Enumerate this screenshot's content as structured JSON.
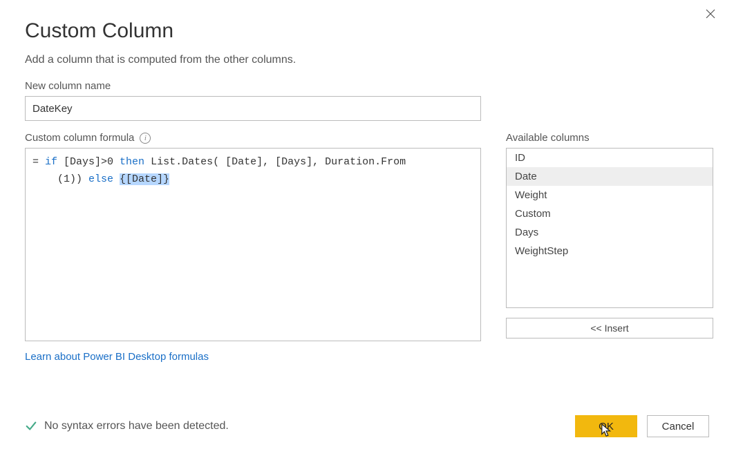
{
  "title": "Custom Column",
  "subtitle": "Add a column that is computed from the other columns.",
  "newColumnLabel": "New column name",
  "newColumnValue": "DateKey",
  "formulaLabel": "Custom column formula",
  "formula": {
    "line1_eq": "= ",
    "line1_kw1": "if",
    "line1_mid1": " [Days]>0 ",
    "line1_kw2": "then",
    "line1_fn": " List.Dates( [Date], [Days], Duration.From",
    "line2_pre": "    (1)) ",
    "line2_kw": "else",
    "line2_sp": " ",
    "line2_hl": "{[Date]}"
  },
  "learnLink": "Learn about Power BI Desktop formulas",
  "availableLabel": "Available columns",
  "availableColumns": [
    "ID",
    "Date",
    "Weight",
    "Custom",
    "Days",
    "WeightStep"
  ],
  "selectedColumnIndex": 1,
  "insertLabel": "<< Insert",
  "status": "No syntax errors have been detected.",
  "okLabel": "OK",
  "cancelLabel": "Cancel"
}
